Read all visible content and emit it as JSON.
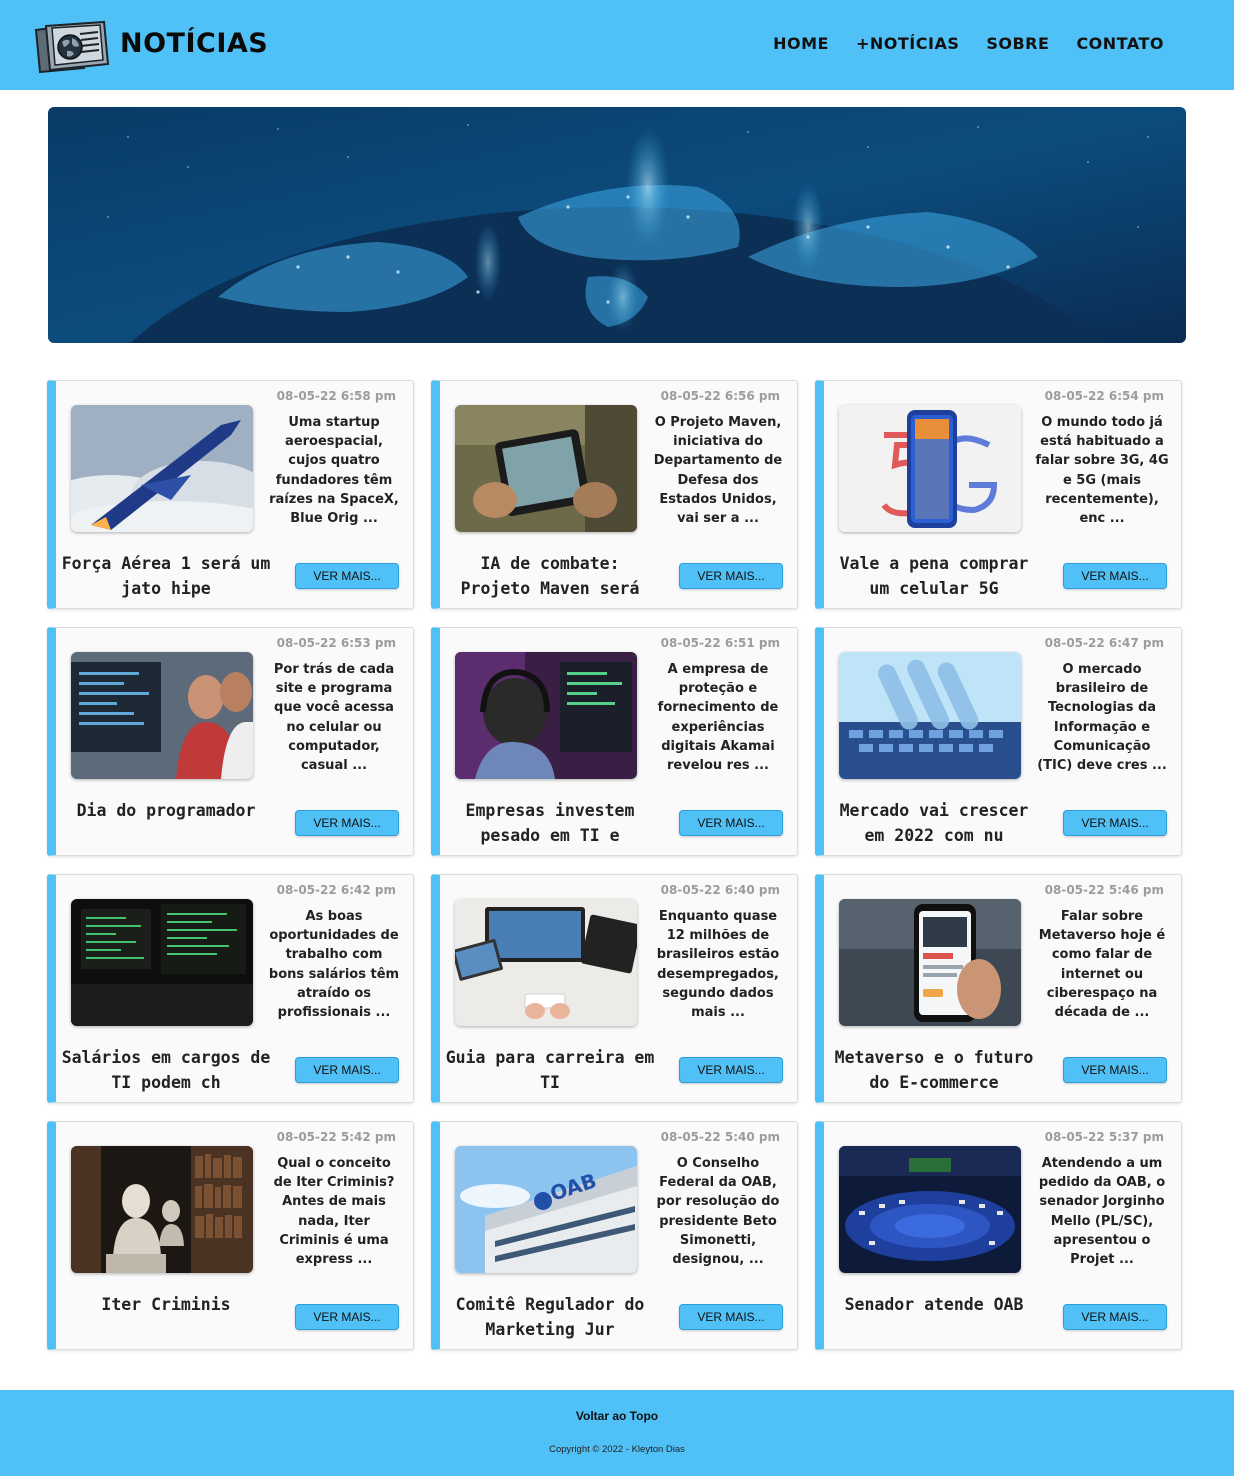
{
  "header": {
    "title": "NOTÍCIAS",
    "logo_icon": "newspaper-globe-icon",
    "nav": [
      {
        "label": "HOME"
      },
      {
        "label": "+NOTÍCIAS"
      },
      {
        "label": "SOBRE"
      },
      {
        "label": "CONTATO"
      }
    ]
  },
  "hero": {
    "image": "earth-at-night-network-globe"
  },
  "colors": {
    "accent": "#4fc1f7",
    "date_gray": "#9c9c9c"
  },
  "cards": [
    {
      "date": "08-05-22 6:58 pm",
      "excerpt": "Uma startup aeroespacial, cujos quatro fundadores têm raízes na SpaceX, Blue Orig ...",
      "title": "Força Aérea 1 será um jato hipe",
      "button": "VER MAIS...",
      "image": "hypersonic-jet"
    },
    {
      "date": "08-05-22 6:56 pm",
      "excerpt": "O Projeto Maven, iniciativa do Departamento de Defesa dos Estados Unidos, vai ser a ...",
      "title": "IA de combate: Projeto Maven será",
      "button": "VER MAIS...",
      "image": "soldier-tablet"
    },
    {
      "date": "08-05-22 6:54 pm",
      "excerpt": "O mundo todo já está habituado a falar sobre 3G, 4G e 5G (mais recentemente), enc ...",
      "title": "Vale a pena comprar um celular 5G",
      "button": "VER MAIS...",
      "image": "5g-phone"
    },
    {
      "date": "08-05-22 6:53 pm",
      "excerpt": "Por trás de cada site e programa que você acessa no celular ou computador, casual ...",
      "title": "Dia do programador",
      "button": "VER MAIS...",
      "image": "programmers-monitor"
    },
    {
      "date": "08-05-22 6:51 pm",
      "excerpt": "A empresa de proteção e fornecimento de experiências digitais Akamai revelou res ...",
      "title": "Empresas investem pesado em TI e",
      "button": "VER MAIS...",
      "image": "headphones-computer"
    },
    {
      "date": "08-05-22 6:47 pm",
      "excerpt": "O mercado brasileiro de Tecnologias da Informação e Comunicação (TIC) deve cres ...",
      "title": "Mercado vai crescer em 2022 com nu",
      "button": "VER MAIS...",
      "image": "hand-keyboard"
    },
    {
      "date": "08-05-22 6:42 pm",
      "excerpt": "As boas oportunidades de trabalho com bons salários têm atraído os profissionais ...",
      "title": "Salários em cargos de TI podem ch",
      "button": "VER MAIS...",
      "image": "code-screens"
    },
    {
      "date": "08-05-22 6:40 pm",
      "excerpt": "Enquanto quase 12 milhões de brasileiros estão desempregados, segundo dados mais ...",
      "title": "Guia para carreira em TI",
      "button": "VER MAIS...",
      "image": "desk-computers"
    },
    {
      "date": "08-05-22 5:46 pm",
      "excerpt": "Falar sobre Metaverso hoje é como falar de internet ou ciberespaço na década de ...",
      "title": "Metaverso e o futuro do E-commerce",
      "button": "VER MAIS...",
      "image": "phone-app"
    },
    {
      "date": "08-05-22 5:42 pm",
      "excerpt": "Qual o conceito de Iter Criminis? Antes de mais nada, Iter Criminis é uma express ...",
      "title": "Iter Criminis",
      "button": "VER MAIS...",
      "image": "library-busts"
    },
    {
      "date": "08-05-22 5:40 pm",
      "excerpt": "O Conselho Federal da OAB, por resolução do presidente Beto Simonetti, designou, ...",
      "title": "Comitê Regulador do Marketing Jur",
      "button": "VER MAIS...",
      "image": "oab-building",
      "image_text": "OAB"
    },
    {
      "date": "08-05-22 5:37 pm",
      "excerpt": "Atendendo a um pedido da OAB, o senador Jorginho Mello (PL/SC), apresentou o Projet ...",
      "title": "Senador atende OAB",
      "button": "VER MAIS...",
      "image": "senate-plenary"
    }
  ],
  "footer": {
    "back_to_top": "Voltar ao Topo",
    "copyright": "Copyright © 2022 - Kleyton Dias"
  }
}
